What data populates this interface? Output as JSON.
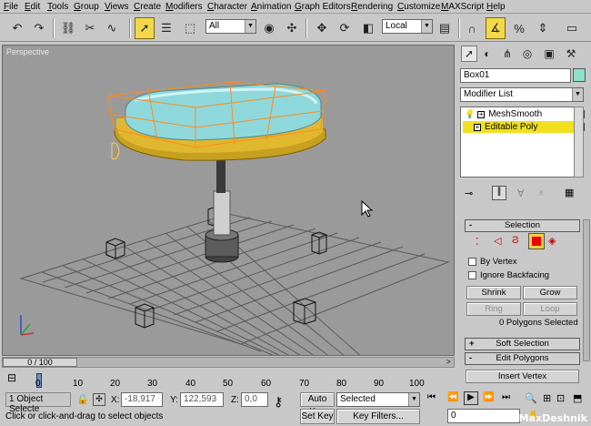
{
  "menu": [
    "File",
    "Edit",
    "Tools",
    "Group",
    "Views",
    "Create",
    "Modifiers",
    "Character",
    "Animation",
    "Graph Editors",
    "Rendering",
    "Customize",
    "MAXScript",
    "Help"
  ],
  "toolbar": {
    "selection_filter": "All",
    "coord_system": "Local",
    "icons": [
      "undo-icon",
      "redo-icon",
      "link-icon",
      "unlink-icon",
      "bind-space-warp-icon",
      "select-icon",
      "select-by-name-icon",
      "rect-region-icon",
      "select-move-icon",
      "select-rotate-icon",
      "select-scale-icon",
      "ref-coord-icon",
      "pivot-icon",
      "mirror-icon",
      "snap-3d-icon",
      "angle-snap-icon",
      "percent-snap-icon",
      "named-selection-icon",
      "align-icon"
    ]
  },
  "viewport": {
    "label": "Perspective"
  },
  "command_panel": {
    "object_name": "Box01",
    "object_color": "#8fe0c8",
    "modifier_list": "Modifier List",
    "stack": [
      {
        "label": "MeshSmooth",
        "selected": false
      },
      {
        "label": "Editable Poly",
        "selected": true
      }
    ],
    "selection_rollout": "Selection",
    "by_vertex": "By Vertex",
    "ignore_backfacing": "Ignore Backfacing",
    "shrink": "Shrink",
    "grow": "Grow",
    "ring": "Ring",
    "loop": "Loop",
    "status": "0 Polygons Selected",
    "soft_selection": "Soft Selection",
    "edit_polygons": "Edit Polygons",
    "insert_vertex": "Insert Vertex",
    "sign_minus": "-",
    "sign_plus": "+"
  },
  "timeline": {
    "frame_label": "0 / 100",
    "ticks": [
      "0",
      "10",
      "20",
      "30",
      "40",
      "50",
      "60",
      "70",
      "80",
      "90",
      "100"
    ]
  },
  "status_bar": {
    "selected_count": "1 Object Selecte",
    "x_label": "X:",
    "x_value": "-18,917",
    "y_label": "Y:",
    "y_value": "122,593",
    "z_label": "Z:",
    "z_value": "0,0",
    "prompt": "Click or click-and-drag to select objects",
    "auto_key": "Auto Key",
    "set_key": "Set Key",
    "key_mode": "Selected",
    "key_filters": "Key Filters...",
    "current_frame": "0"
  },
  "watermark": "3dsMaxDeshnik"
}
